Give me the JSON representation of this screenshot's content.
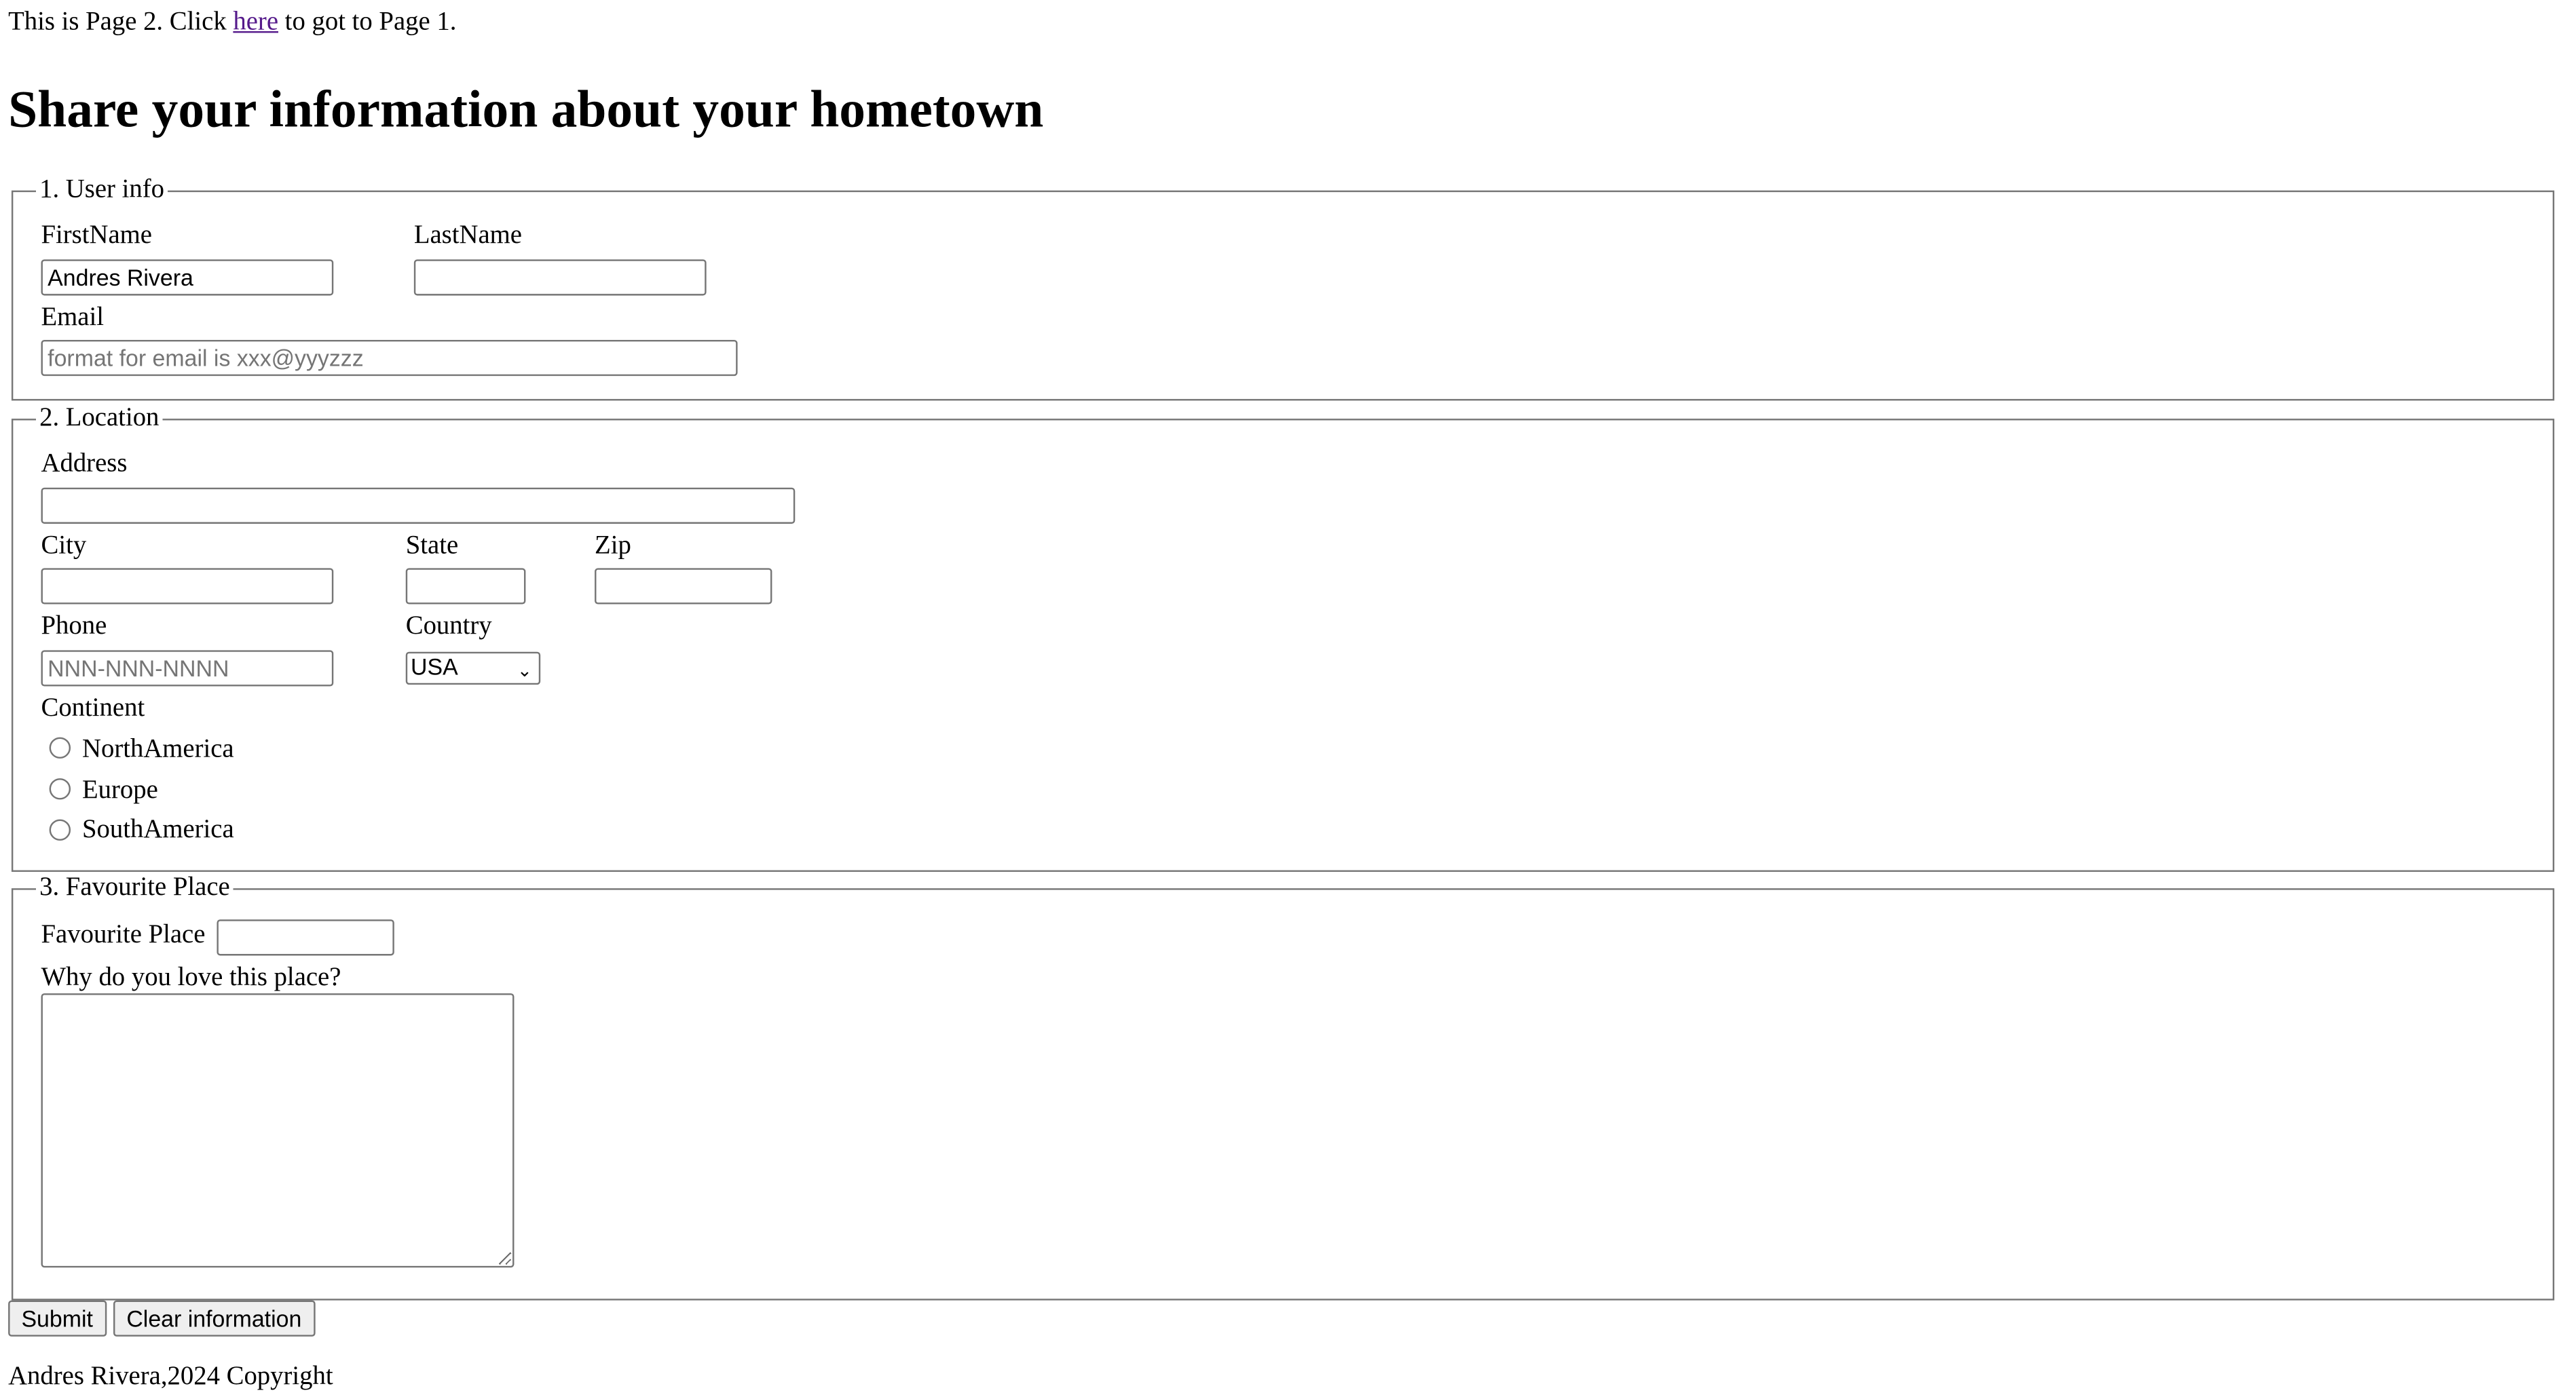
{
  "top_line": {
    "before": "This is Page 2. Click ",
    "link": "here",
    "after": " to got to Page 1."
  },
  "heading": "Share your information about your hometown",
  "user_info": {
    "legend": "1. User info",
    "first_name_label": "FirstName",
    "first_name_value": "Andres Rivera",
    "last_name_label": "LastName",
    "last_name_value": "",
    "email_label": "Email",
    "email_placeholder": "format for email is xxx@yyyzzz"
  },
  "location": {
    "legend": "2. Location",
    "address_label": "Address",
    "city_label": "City",
    "state_label": "State",
    "zip_label": "Zip",
    "phone_label": "Phone",
    "phone_placeholder": "NNN-NNN-NNNN",
    "country_label": "Country",
    "country_selected": "USA",
    "continent_label": "Continent",
    "continents": [
      "NorthAmerica",
      "Europe",
      "SouthAmerica"
    ]
  },
  "favourite": {
    "legend": "3. Favourite Place",
    "place_label": "Favourite Place",
    "why_label": "Why do you love this place?"
  },
  "buttons": {
    "submit": "Submit",
    "clear": "Clear information"
  },
  "footer": "Andres Rivera,2024 Copyright"
}
